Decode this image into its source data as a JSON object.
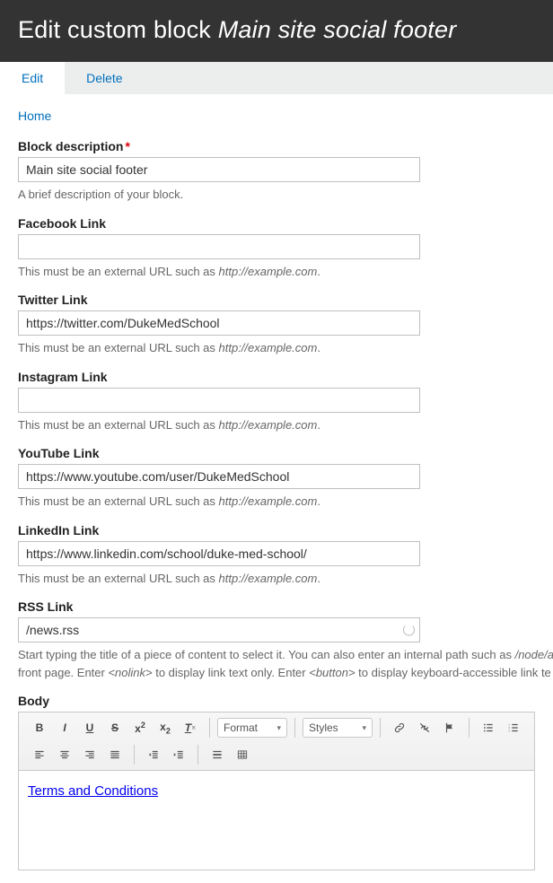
{
  "header": {
    "title_prefix": "Edit custom block ",
    "title_italic": "Main site social footer"
  },
  "tabs": {
    "edit": "Edit",
    "delete": "Delete"
  },
  "breadcrumb": {
    "home": "Home"
  },
  "fields": {
    "block_description": {
      "label": "Block description",
      "value": "Main site social footer",
      "help": "A brief description of your block."
    },
    "facebook": {
      "label": "Facebook Link",
      "value": "",
      "help_pre": "This must be an external URL such as ",
      "help_em": "http://example.com",
      "help_post": "."
    },
    "twitter": {
      "label": "Twitter Link",
      "value": "https://twitter.com/DukeMedSchool",
      "help_pre": "This must be an external URL such as ",
      "help_em": "http://example.com",
      "help_post": "."
    },
    "instagram": {
      "label": "Instagram Link",
      "value": "",
      "help_pre": "This must be an external URL such as ",
      "help_em": "http://example.com",
      "help_post": "."
    },
    "youtube": {
      "label": "YouTube Link",
      "value": "https://www.youtube.com/user/DukeMedSchool",
      "help_pre": "This must be an external URL such as ",
      "help_em": "http://example.com",
      "help_post": "."
    },
    "linkedin": {
      "label": "LinkedIn Link",
      "value": "https://www.linkedin.com/school/duke-med-school/",
      "help_pre": "This must be an external URL such as ",
      "help_em": "http://example.com",
      "help_post": "."
    },
    "rss": {
      "label": "RSS Link",
      "value": "/news.rss",
      "help_pre": "Start typing the title of a piece of content to select it. You can also enter an internal path such as ",
      "help_em1": "/node/a",
      "help_mid1": " front page. Enter ",
      "help_em2": "<nolink>",
      "help_mid2": " to display link text only. Enter ",
      "help_em3": "<button>",
      "help_post": " to display keyboard-accessible link te"
    },
    "body": {
      "label": "Body"
    }
  },
  "toolbar": {
    "format_label": "Format",
    "styles_label": "Styles"
  },
  "editor": {
    "body_link_text": "Terms and Conditions"
  }
}
